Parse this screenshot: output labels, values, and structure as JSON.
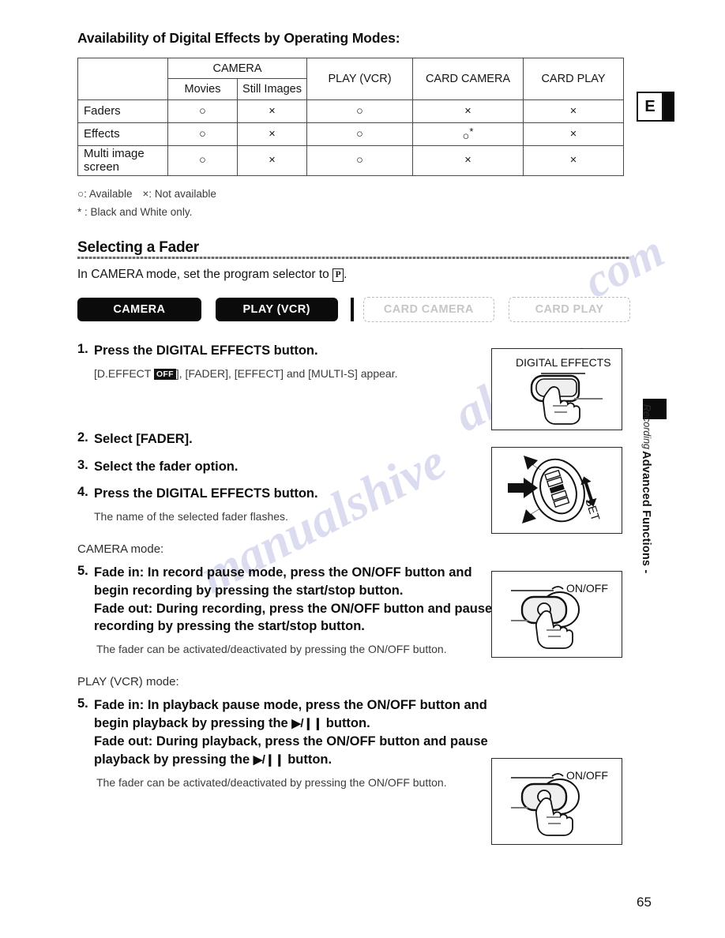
{
  "document": {
    "page_number": "65",
    "language_tab": "E",
    "side_chapter_main": "Advanced Functions -",
    "side_chapter_sub": "Recording"
  },
  "watermark": {
    "line1": "manualshive",
    "line2": "alshive",
    "line3": ". com"
  },
  "availability": {
    "title": "Availability of Digital Effects by Operating Modes:",
    "headers": {
      "blank": "",
      "camera": "CAMERA",
      "movies": "Movies",
      "still_images": "Still Images",
      "play_vcr": "PLAY (VCR)",
      "card_camera": "CARD CAMERA",
      "card_play": "CARD PLAY"
    },
    "rows": [
      {
        "label": "Faders",
        "movies": "○",
        "still_images": "×",
        "play_vcr": "○",
        "card_camera": "×",
        "card_play": "×"
      },
      {
        "label": "Effects",
        "movies": "○",
        "still_images": "×",
        "play_vcr": "○",
        "card_camera": "○",
        "card_camera_star": "*",
        "card_play": "×"
      },
      {
        "label": "Multi image screen",
        "movies": "○",
        "still_images": "×",
        "play_vcr": "○",
        "card_camera": "×",
        "card_play": "×"
      }
    ],
    "legend_line1_a": "○: Available",
    "legend_line1_b": "×: Not available",
    "legend_line2": "* : Black and White only."
  },
  "fader_section": {
    "heading": "Selecting a Fader",
    "intro_before": "In CAMERA mode, set the program selector to",
    "intro_symbol": "P",
    "intro_after": ".",
    "modes": [
      {
        "label": "CAMERA",
        "active": true
      },
      {
        "label": "PLAY (VCR)",
        "active": true
      },
      {
        "label": "CARD CAMERA",
        "active": false
      },
      {
        "label": "CARD PLAY",
        "active": false
      }
    ],
    "steps": [
      {
        "num": "1.",
        "text_before": "Press the DIGITAL EFFECTS button.",
        "note_a": "[D.EFFECT",
        "note_badge": "OFF",
        "note_b": "], [FADER], [EFFECT] and [MULTI-S] appear."
      },
      {
        "num": "2.",
        "text": "Select [FADER]."
      },
      {
        "num": "3.",
        "text": "Select the fader option."
      },
      {
        "num": "4.",
        "text": "Press the DIGITAL EFFECTS button.",
        "note": "The name of the selected fader flashes."
      }
    ],
    "camera_mode": {
      "label": "CAMERA mode:",
      "num": "5.",
      "line1": "Fade in: In record pause mode, press the ON/OFF button and begin recording by pressing the start/stop button.",
      "line2": "Fade out: During recording, press the ON/OFF button and pause recording by pressing the start/stop button.",
      "note": "The fader can be activated/deactivated by pressing the ON/OFF button."
    },
    "play_mode": {
      "label": "PLAY (VCR) mode:",
      "num": "5.",
      "line1_a": "Fade in: In playback pause mode, press the ON/OFF button and begin playback by pressing the",
      "line1_sym": "▶/❙❙",
      "line1_b": "button.",
      "line2_a": "Fade out: During playback, press the ON/OFF button and pause playback by pressing the",
      "line2_sym": "▶/❙❙",
      "line2_b": "button.",
      "note": "The fader can be activated/deactivated by pressing the ON/OFF button."
    }
  },
  "illustrations": {
    "digital_effects_label": "DIGITAL EFFECTS",
    "set_dial_label": "SET",
    "onoff_label_camera": "ON/OFF",
    "onoff_label_play": "ON/OFF"
  }
}
